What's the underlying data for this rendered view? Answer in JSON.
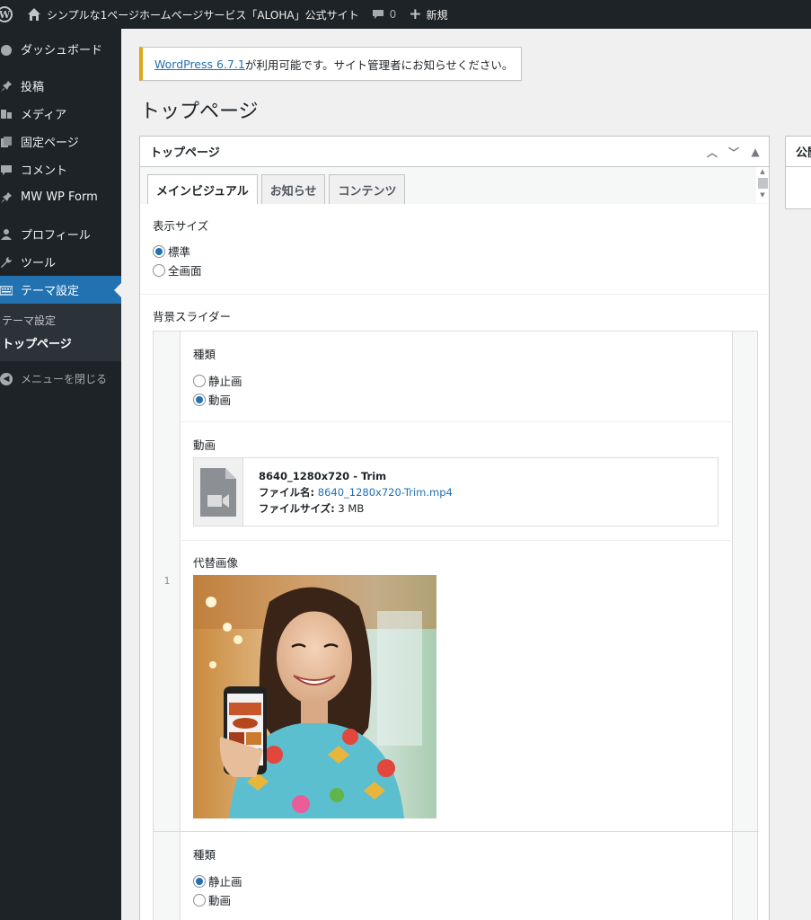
{
  "adminbar": {
    "site_name": "シンプルな1ページホームページサービス「ALOHA」公式サイト",
    "comment_count": "0",
    "new_label": "新規"
  },
  "sidebar": {
    "items": [
      {
        "label": "ダッシュボード",
        "icon": "dashboard-icon"
      },
      {
        "label": "投稿",
        "icon": "pin-icon"
      },
      {
        "label": "メディア",
        "icon": "media-icon"
      },
      {
        "label": "固定ページ",
        "icon": "pages-icon"
      },
      {
        "label": "コメント",
        "icon": "comment-icon"
      },
      {
        "label": "MW WP Form",
        "icon": "pin-icon"
      },
      {
        "label": "プロフィール",
        "icon": "user-icon"
      },
      {
        "label": "ツール",
        "icon": "wrench-icon"
      },
      {
        "label": "テーマ設定",
        "icon": "keyboard-icon"
      }
    ],
    "submenu": [
      "テーマ設定",
      "トップページ"
    ],
    "collapse_label": "メニューを閉じる"
  },
  "notice": {
    "link_text": "WordPress 6.7.1",
    "text": " が利用可能です。サイト管理者にお知らせください。"
  },
  "page_title": "トップページ",
  "metabox": {
    "title": "トップページ",
    "tabs": [
      "メインビジュアル",
      "お知らせ",
      "コンテンツ"
    ],
    "display_size": {
      "label": "表示サイズ",
      "options": [
        "標準",
        "全画面"
      ],
      "selected": "標準"
    },
    "slider_label": "背景スライダー",
    "rows": [
      {
        "number": "1",
        "type_label": "種類",
        "type_options": [
          "静止画",
          "動画"
        ],
        "type_selected": "動画",
        "video_label": "動画",
        "file_title": "8640_1280x720 - Trim",
        "file_name_label": "ファイル名:",
        "file_name": "8640_1280x720-Trim.mp4",
        "file_size_label": "ファイルサイズ:",
        "file_size": "3 MB",
        "alt_image_label": "代替画像"
      },
      {
        "type_label": "種類",
        "type_options": [
          "静止画",
          "動画"
        ],
        "type_selected": "静止画"
      }
    ]
  },
  "sidebox": {
    "title": "公開"
  }
}
